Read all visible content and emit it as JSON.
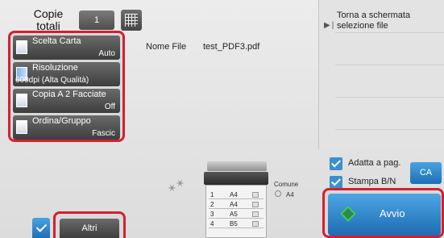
{
  "header": {
    "copies_label": "Copie totali",
    "copies_value": "1"
  },
  "functions": [
    {
      "label": "Scelta Carta",
      "value": "Auto",
      "icon": "paper-icon"
    },
    {
      "label": "Risoluzione",
      "value": "600dpi (Alta Qualità)",
      "icon": "resolution-icon"
    },
    {
      "label": "Copia A 2 Facciate",
      "value": "Off",
      "icon": "duplex-icon"
    },
    {
      "label": "Ordina/Gruppo",
      "value": "Fascic",
      "icon": "sort-icon"
    }
  ],
  "file": {
    "label": "Nome File",
    "value": "test_PDF3.pdf"
  },
  "right": {
    "back_label": "Torna a schermata selezione file"
  },
  "options": {
    "fit_label": "Adatta a pag.",
    "bw_label": "Stampa B/N",
    "ca_label": "CA"
  },
  "start": {
    "label": "Avvio"
  },
  "others": {
    "label": "Altri"
  },
  "machine": {
    "trays": [
      {
        "num": "1",
        "size": "A4"
      },
      {
        "num": "2",
        "size": "A4"
      },
      {
        "num": "3",
        "size": "A5"
      },
      {
        "num": "4",
        "size": "B5"
      }
    ],
    "bypass_label": "Comune",
    "bypass_size": "A4"
  },
  "colors": {
    "accent": "#d4202e",
    "button_blue": "#1f6fb5"
  }
}
